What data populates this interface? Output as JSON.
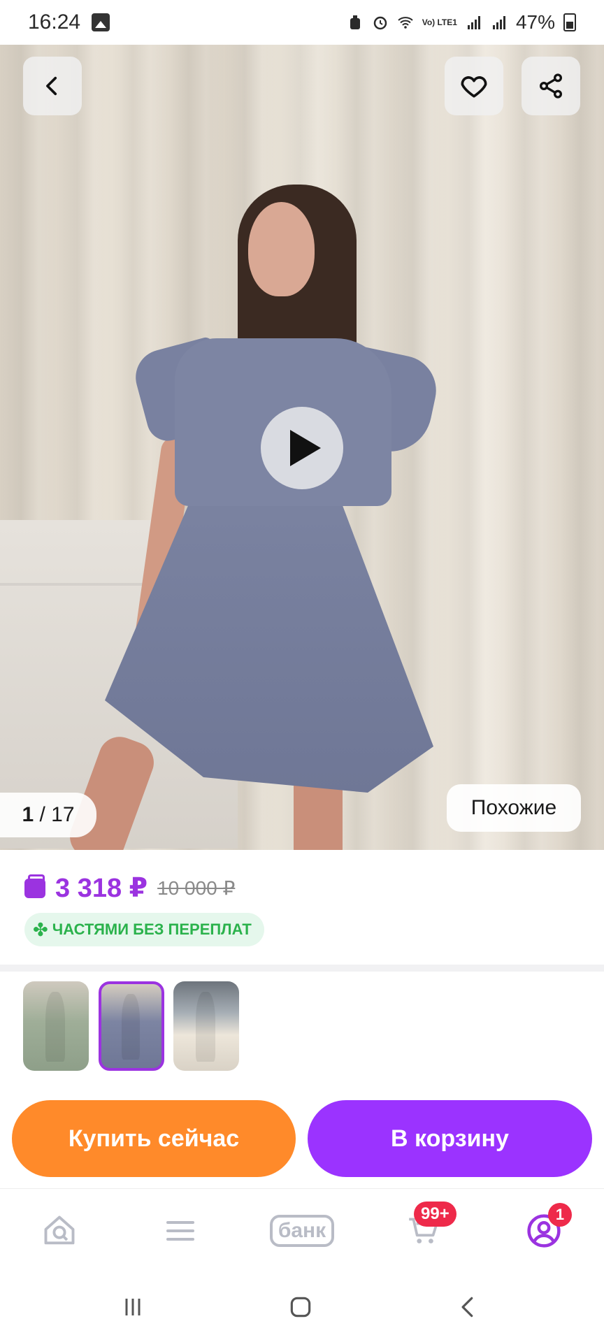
{
  "status_bar": {
    "time": "16:24",
    "network_label": "Vo) LTE1",
    "battery": "47%"
  },
  "product": {
    "image_counter_current": "1",
    "image_counter_total": "/ 17",
    "similar_label": "Похожие",
    "price_current": "3 318 ₽",
    "price_old": "10 000 ₽",
    "installment_label": "ЧАСТЯМИ БЕЗ ПЕРЕПЛАТ",
    "variants": [
      {
        "color": "#9fae98",
        "selected": false
      },
      {
        "color": "#7c84a2",
        "selected": true
      },
      {
        "color": "#ede6da",
        "selected": false
      }
    ]
  },
  "actions": {
    "buy_now": "Купить сейчас",
    "add_to_cart": "В корзину"
  },
  "bottom_nav": {
    "bank_label": "банк",
    "cart_badge": "99+",
    "profile_badge": "1"
  },
  "colors": {
    "accent": "#9b33e0",
    "buy_button": "#ff8a2a",
    "cart_button": "#9b33ff",
    "installment_green": "#2bb24c",
    "badge_red": "#ee2a4a"
  }
}
